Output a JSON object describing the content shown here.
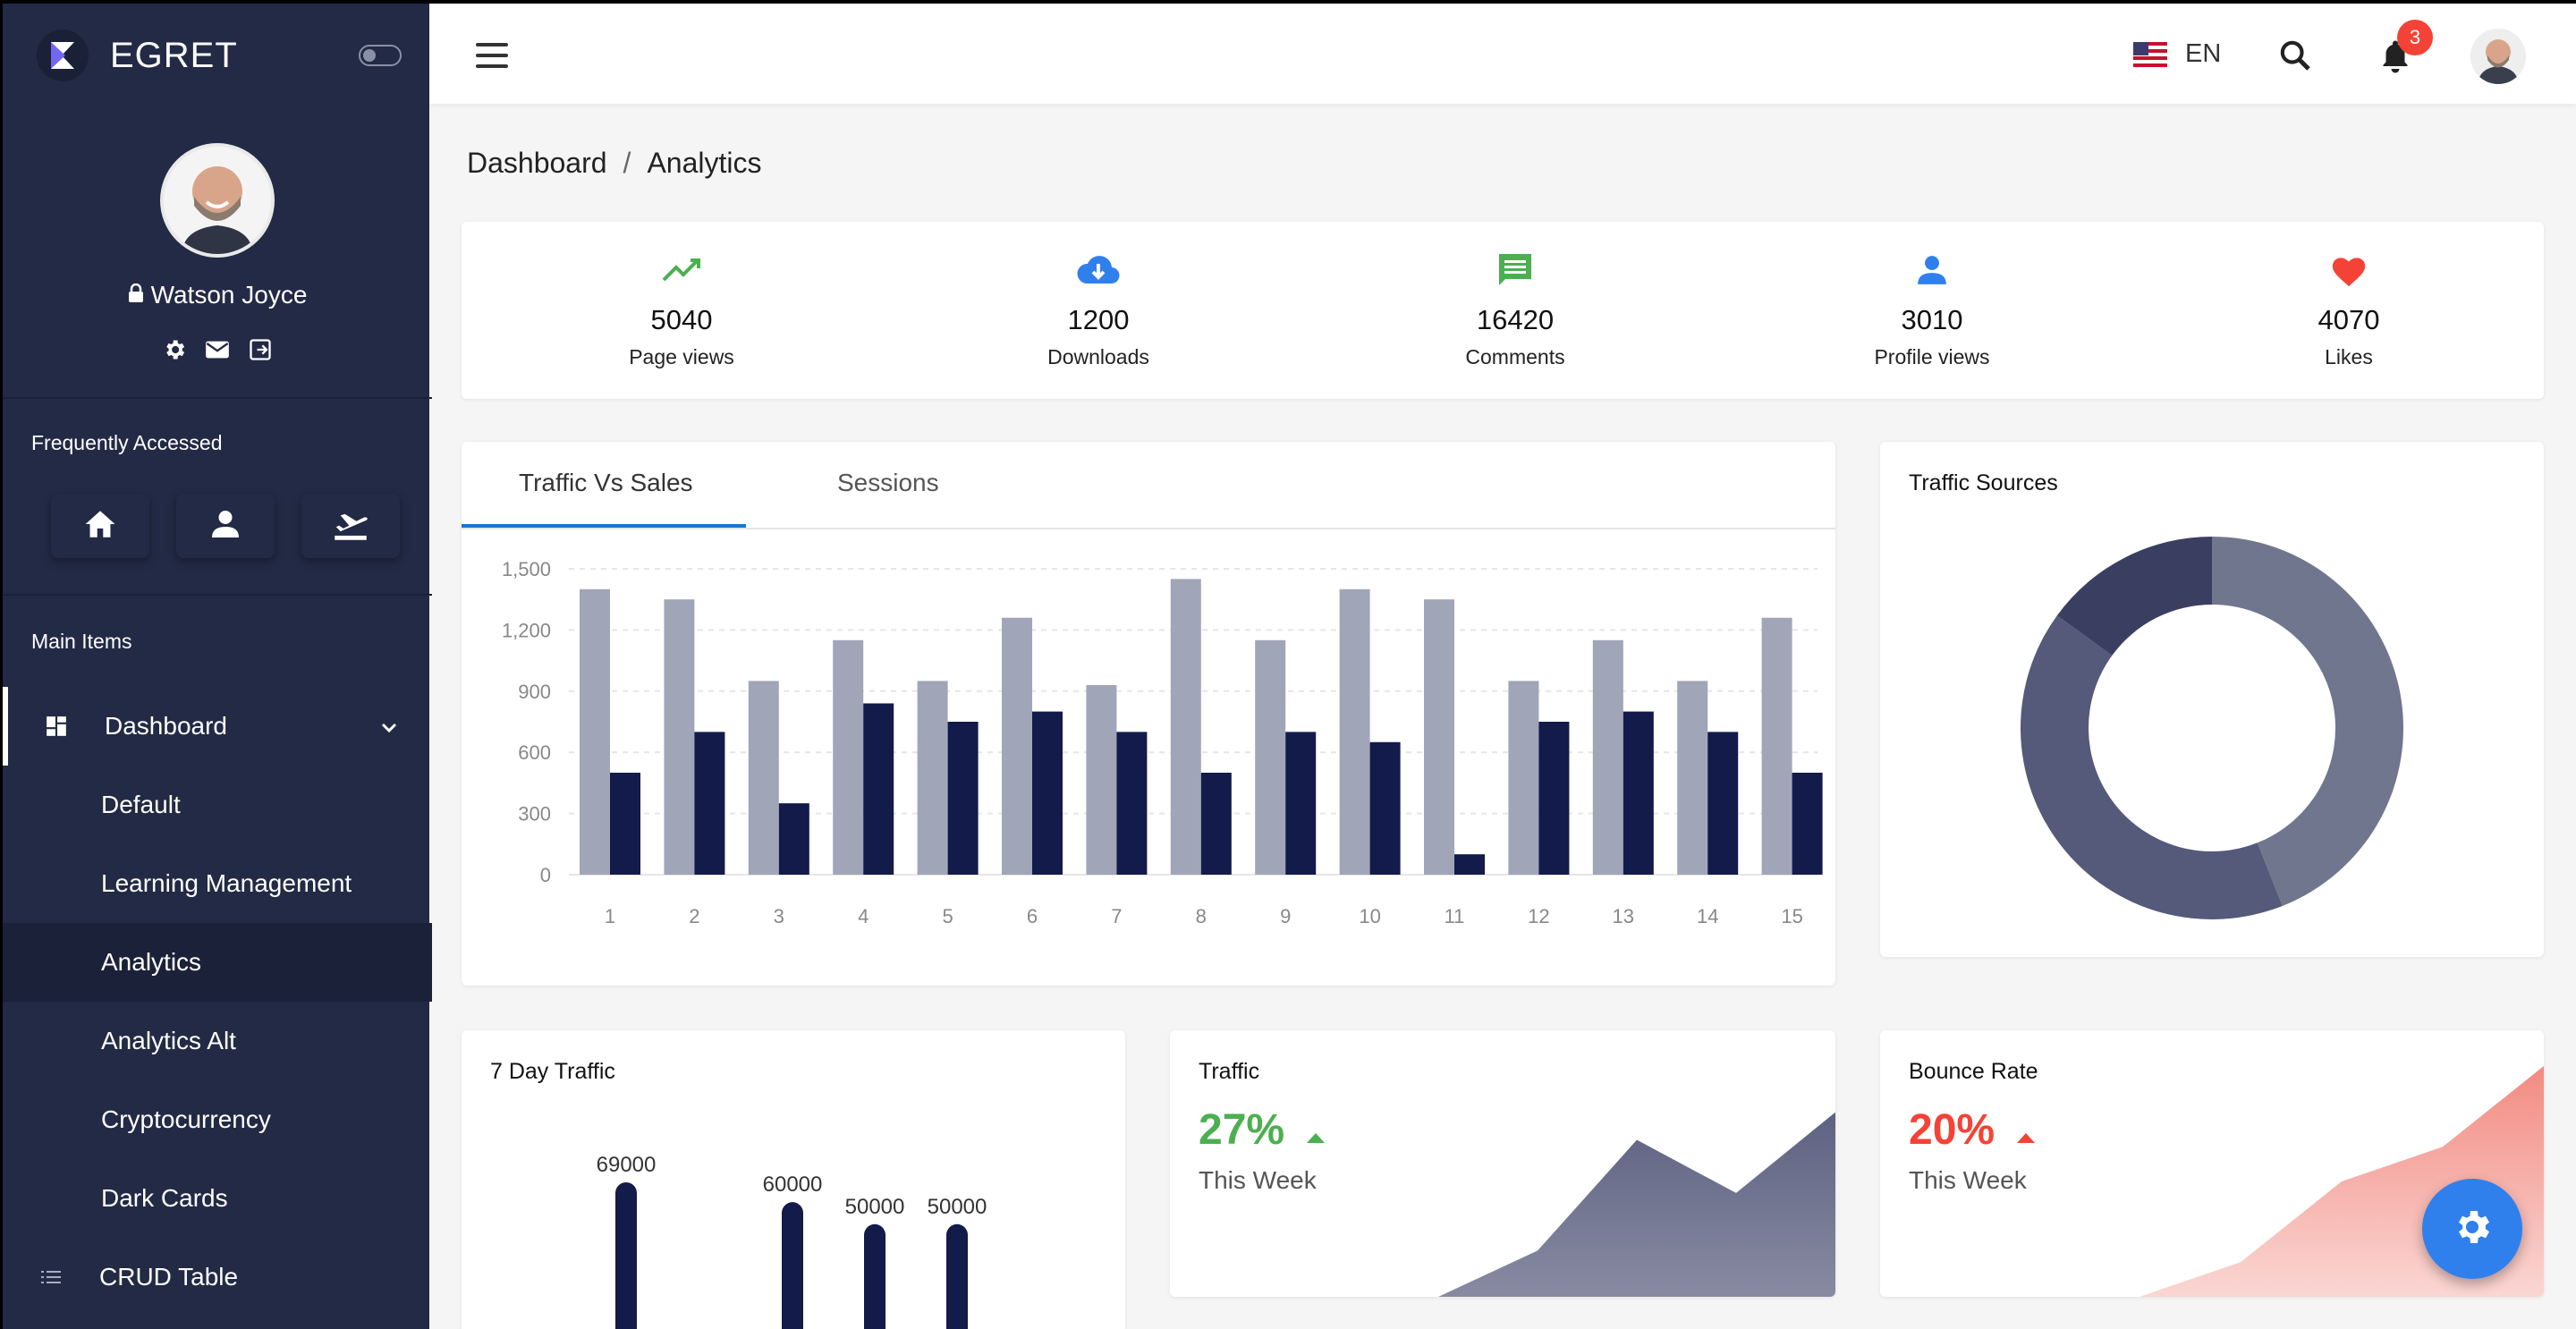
{
  "brand": {
    "name": "EGRET"
  },
  "user": {
    "name": "Watson Joyce"
  },
  "sidebar": {
    "frequent_label": "Frequently Accessed",
    "main_label": "Main Items",
    "dashboard_label": "Dashboard",
    "sub_items": [
      "Default",
      "Learning Management",
      "Analytics",
      "Analytics Alt",
      "Cryptocurrency",
      "Dark Cards"
    ],
    "crud_label": "CRUD Table"
  },
  "topbar": {
    "lang": "EN",
    "notification_count": "3"
  },
  "breadcrumb": {
    "root": "Dashboard",
    "sep": "/",
    "current": "Analytics"
  },
  "stats": [
    {
      "value": "5040",
      "label": "Page views",
      "icon": "trending-up-icon",
      "color": "#4caf50"
    },
    {
      "value": "1200",
      "label": "Downloads",
      "icon": "cloud-download-icon",
      "color": "#2f80ed"
    },
    {
      "value": "16420",
      "label": "Comments",
      "icon": "comment-icon",
      "color": "#4caf50"
    },
    {
      "value": "3010",
      "label": "Profile views",
      "icon": "person-icon",
      "color": "#2f80ed"
    },
    {
      "value": "4070",
      "label": "Likes",
      "icon": "heart-icon",
      "color": "#f44336"
    }
  ],
  "tabs": {
    "traffic_vs_sales": "Traffic Vs Sales",
    "sessions": "Sessions"
  },
  "titles": {
    "traffic_sources": "Traffic Sources",
    "seven_day": "7 Day Traffic",
    "traffic": "Traffic",
    "bounce": "Bounce Rate"
  },
  "traffic": {
    "pct": "27%",
    "sub": "This Week",
    "color": "#4caf50"
  },
  "bounce": {
    "pct": "20%",
    "sub": "This Week",
    "color": "#f44336"
  },
  "chart_data": [
    {
      "type": "bar",
      "categories": [
        "1",
        "2",
        "3",
        "4",
        "5",
        "6",
        "7",
        "8",
        "9",
        "10",
        "11",
        "12",
        "13",
        "14",
        "15"
      ],
      "series": [
        {
          "values": [
            1400,
            1350,
            950,
            1150,
            950,
            1260,
            930,
            1450,
            1150,
            1400,
            1350,
            950,
            1150,
            950,
            1260
          ],
          "color": "#a1a5b8"
        },
        {
          "values": [
            500,
            700,
            350,
            840,
            750,
            800,
            700,
            500,
            700,
            650,
            100,
            750,
            800,
            700,
            500
          ],
          "color": "#121b4a"
        }
      ],
      "ylim": [
        0,
        1500
      ],
      "yticks": [
        "0",
        "300",
        "600",
        "900",
        "1,200",
        "1,500"
      ],
      "grid": true
    },
    {
      "type": "pie",
      "values": [
        44,
        41,
        15
      ],
      "colors": [
        "#71768f",
        "#55597a",
        "#3a3f62"
      ],
      "donut": true
    },
    {
      "type": "bar",
      "data_labels": [
        "69000",
        "60000",
        "50000",
        "50000"
      ],
      "values": [
        69000,
        60000,
        50000,
        50000
      ]
    },
    {
      "type": "area",
      "values": [
        0,
        20,
        68,
        45,
        80
      ],
      "color": "#55597a"
    },
    {
      "type": "area",
      "values": [
        0,
        15,
        50,
        65,
        100
      ],
      "color": "#f28b82"
    }
  ]
}
